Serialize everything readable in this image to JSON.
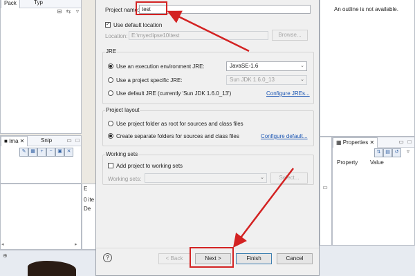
{
  "left_top": {
    "tab1": "Pack",
    "tab2": "Typ"
  },
  "left_mid": {
    "tab1": "Ima",
    "tab2": "Snip"
  },
  "left_bottom": {
    "tab1": "E",
    "row1": "0 ite",
    "row2": "De"
  },
  "right_top": {
    "message": "An outline is not available."
  },
  "right_props": {
    "title": "Properties",
    "col_property": "Property",
    "col_value": "Value"
  },
  "dialog": {
    "project_name_label": "Project name:",
    "project_name_value": "test",
    "use_default_location_label": "Use default location",
    "location_label": "Location:",
    "location_value": "E:\\myeclipse10\\test",
    "browse_label": "Browse...",
    "jre": {
      "title": "JRE",
      "option1": "Use an execution environment JRE:",
      "option1_select": "JavaSE-1.6",
      "option2": "Use a project specific JRE:",
      "option2_select": "Sun JDK 1.6.0_13",
      "option3": "Use default JRE (currently 'Sun JDK 1.6.0_13')",
      "configure_link": "Configure JREs..."
    },
    "layout": {
      "title": "Project layout",
      "option1": "Use project folder as root for sources and class files",
      "option2": "Create separate folders for sources and class files",
      "configure_link": "Configure default..."
    },
    "working_sets": {
      "title": "Working sets",
      "add_label": "Add project to working sets",
      "field_label": "Working sets:",
      "select_label": "Select..."
    },
    "buttons": {
      "help": "?",
      "back": "< Back",
      "next": "Next >",
      "finish": "Finish",
      "cancel": "Cancel"
    }
  },
  "colors": {
    "annotation": "#d32222",
    "link": "#1a55b3",
    "dialog_bg": "#f0f0f0"
  }
}
